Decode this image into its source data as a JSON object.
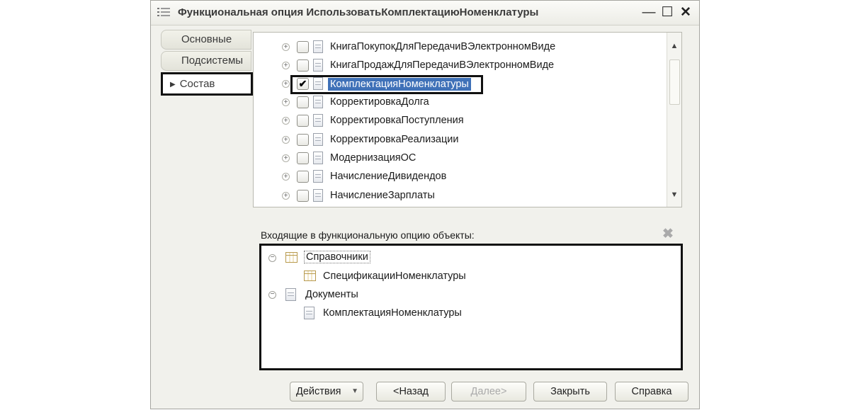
{
  "window": {
    "title": "Функциональная опция ИспользоватьКомплектациюНоменклатуры",
    "controls": {
      "minimize": "—",
      "maximize": "☐",
      "close": "✕"
    }
  },
  "tabs": [
    {
      "label": "Основные",
      "active": false
    },
    {
      "label": "Подсистемы",
      "active": false
    },
    {
      "label": "Состав",
      "active": true
    }
  ],
  "objects_tree": {
    "rows": [
      {
        "label": "КнигаПокупокДляПередачиВЭлектронномВиде",
        "checked": false
      },
      {
        "label": "КнигаПродажДляПередачиВЭлектронномВиде",
        "checked": false
      },
      {
        "label": "КомплектацияНоменклатуры",
        "checked": true,
        "selected": true
      },
      {
        "label": "КорректировкаДолга",
        "checked": false
      },
      {
        "label": "КорректировкаПоступления",
        "checked": false
      },
      {
        "label": "КорректировкаРеализации",
        "checked": false
      },
      {
        "label": "МодернизацияОС",
        "checked": false
      },
      {
        "label": "НачислениеДивидендов",
        "checked": false
      },
      {
        "label": "НачислениеЗарплаты",
        "checked": false
      }
    ],
    "expander_symbol": "+",
    "check_symbol": "✔",
    "scroll_up": "▲",
    "scroll_down": "▼"
  },
  "included": {
    "label": "Входящие в функциональную опцию объекты:",
    "clear_icon": "✖",
    "collapse_symbol": "−",
    "groups": [
      {
        "label": "Справочники",
        "icon": "catalog-icon",
        "items": [
          "СпецификацииНоменклатуры"
        ]
      },
      {
        "label": "Документы",
        "icon": "document-icon",
        "items": [
          "КомплектацияНоменклатуры"
        ]
      }
    ]
  },
  "buttons": {
    "actions": "Действия",
    "actions_caret": "▼",
    "back": "<Назад",
    "next": "Далее>",
    "close": "Закрыть",
    "help": "Справка"
  }
}
